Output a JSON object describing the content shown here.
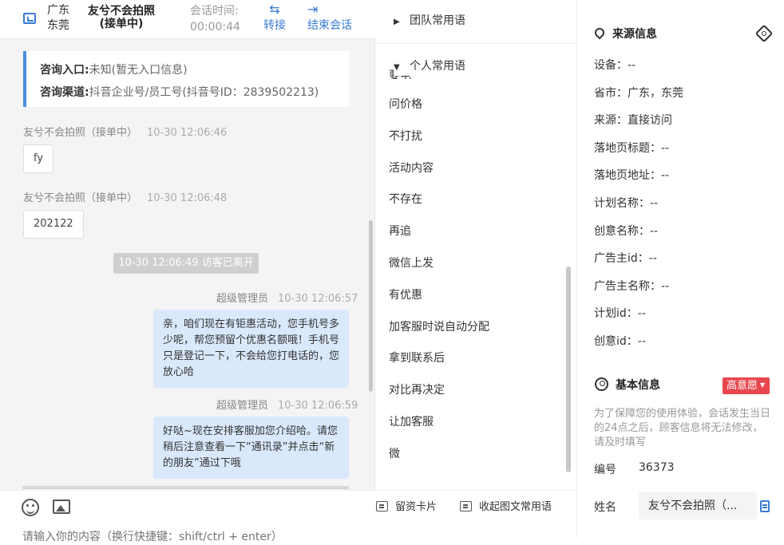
{
  "header": {
    "location_province": "广东",
    "location_city": "东莞",
    "visitor_name": "友兮不会拍照",
    "visitor_status": "(接单中)",
    "time_label": "会话时间:",
    "time_value": "00:00:44",
    "transfer_label": "转接",
    "end_label": "结束会话"
  },
  "consult": {
    "entry_label": "咨询入口:",
    "entry_value": "未知(暂无入口信息)",
    "channel_label": "咨询渠道:",
    "channel_value": "抖音企业号/员工号(抖音号ID：2839502213)"
  },
  "messages": [
    {
      "sender": "友兮不会拍照（接单中）",
      "time": "10-30 12:06:46",
      "text": "fy"
    },
    {
      "sender": "友兮不会拍照（接单中）",
      "time": "10-30 12:06:48",
      "text": "202122"
    },
    {
      "system": "10-30 12:06:49 访客已离开"
    },
    {
      "sender": "超级管理员",
      "time": "10-30 12:06:57",
      "text": "亲，咱们现在有钜惠活动，您手机号多少呢，帮您预留个优惠名额哦！手机号只是登记一下，不会给您打电话的，您放心哈"
    },
    {
      "sender": "超级管理员",
      "time": "10-30 12:06:59",
      "text": "好哒~现在安排客服加您介绍哈。请您稍后注意查看一下“通讯录”并点击“新的朋友”通过下哦"
    }
  ],
  "phrases": {
    "team_group": "团队常用语",
    "personal_group": "个人常用语",
    "clipped_item": "要电话",
    "items": [
      "问价格",
      "不打扰",
      "活动内容",
      "不存在",
      "再追",
      "微信上发",
      "有优惠",
      "加客服时说自动分配",
      "拿到联系后",
      "对比再决定",
      "让加客服",
      "微"
    ]
  },
  "input_bar": {
    "leave_card_label": "留资卡片",
    "collapse_label": "收起图文常用语",
    "placeholder": "请输入你的内容（换行快捷键：shift/ctrl + enter）"
  },
  "info": {
    "source_title": "来源信息",
    "source_rows": [
      "设备：--",
      "省市：广东，东莞",
      "来源：直接访问",
      "落地页标题：--",
      "落地页地址：--",
      "计划名称：--",
      "创意名称：--",
      "广告主id：--",
      "广告主名称：--",
      "计划id：--",
      "创意id：--"
    ],
    "basic_title": "基本信息",
    "intent_label": "高意愿",
    "hint": "为了保障您的使用体验，会话发生当日的24点之后，顾客信息将无法修改，请及时填写",
    "number_label": "编号",
    "number_value": "36373",
    "name_label": "姓名",
    "name_value": "友兮不会拍照（..."
  },
  "colors": {
    "accent_blue": "#3a7bd5",
    "bubble_blue": "#dae8fb",
    "badge_red": "#e8474e"
  }
}
